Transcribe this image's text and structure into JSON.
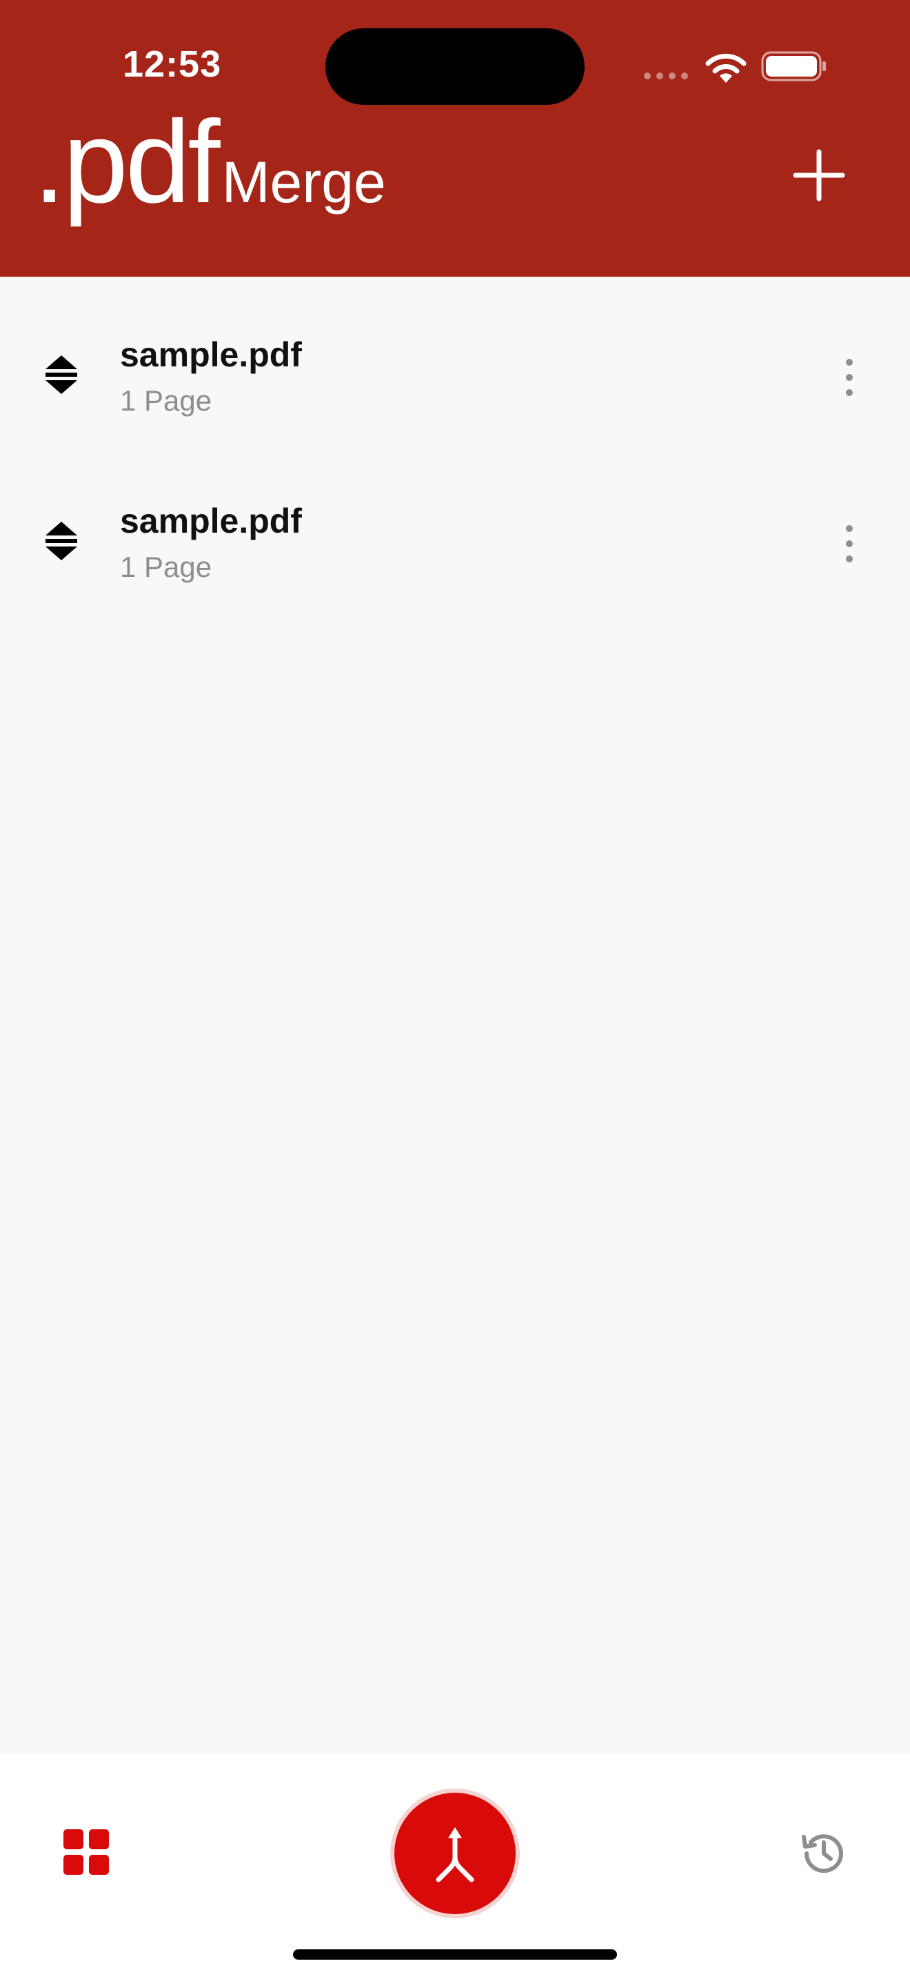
{
  "status_bar": {
    "time": "12:53",
    "icons": [
      "cellular-signal-icon",
      "wifi-icon",
      "battery-icon"
    ]
  },
  "header": {
    "logo_primary": ".pdf",
    "logo_secondary": "Merge",
    "add_icon": "plus-icon",
    "background_color": "#a52518"
  },
  "files": [
    {
      "name": "sample.pdf",
      "pages": "1 Page",
      "handle_icon": "reorder-handle-icon",
      "menu_icon": "more-vertical-icon"
    },
    {
      "name": "sample.pdf",
      "pages": "1 Page",
      "handle_icon": "reorder-handle-icon",
      "menu_icon": "more-vertical-icon"
    }
  ],
  "bottom_bar": {
    "left_icon": "grid-icon",
    "center_icon": "merge-icon",
    "right_icon": "history-icon",
    "accent_color": "#d90a0a"
  }
}
